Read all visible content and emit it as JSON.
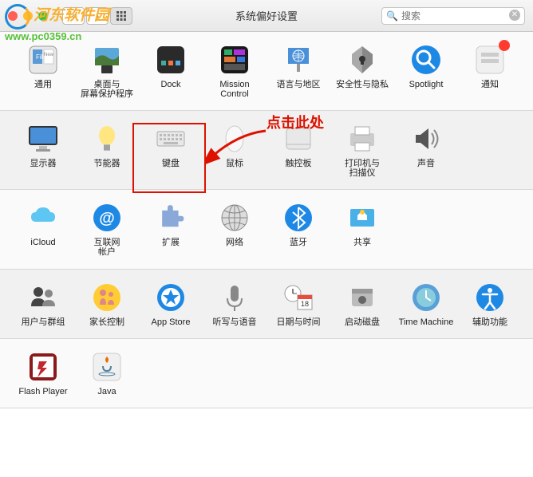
{
  "window": {
    "title": "系统偏好设置"
  },
  "search": {
    "placeholder": "搜索"
  },
  "callout": "点击此处",
  "watermark": {
    "text": "河东软件园",
    "url": "www.pc0359.cn"
  },
  "rows": [
    [
      {
        "key": "general",
        "label": "通用"
      },
      {
        "key": "desktop",
        "label": "桌面与\n屏幕保护程序"
      },
      {
        "key": "dock",
        "label": "Dock"
      },
      {
        "key": "mission",
        "label": "Mission\nControl"
      },
      {
        "key": "language",
        "label": "语言与地区"
      },
      {
        "key": "security",
        "label": "安全性与隐私"
      },
      {
        "key": "spotlight",
        "label": "Spotlight"
      },
      {
        "key": "notifications",
        "label": "通知"
      }
    ],
    [
      {
        "key": "displays",
        "label": "显示器"
      },
      {
        "key": "energy",
        "label": "节能器"
      },
      {
        "key": "keyboard",
        "label": "键盘"
      },
      {
        "key": "mouse",
        "label": "鼠标"
      },
      {
        "key": "trackpad",
        "label": "触控板"
      },
      {
        "key": "printers",
        "label": "打印机与\n扫描仪"
      },
      {
        "key": "sound",
        "label": "声音"
      }
    ],
    [
      {
        "key": "icloud",
        "label": "iCloud"
      },
      {
        "key": "internet",
        "label": "互联网\n帐户"
      },
      {
        "key": "extensions",
        "label": "扩展"
      },
      {
        "key": "network",
        "label": "网络"
      },
      {
        "key": "bluetooth",
        "label": "蓝牙"
      },
      {
        "key": "sharing",
        "label": "共享"
      }
    ],
    [
      {
        "key": "users",
        "label": "用户与群组"
      },
      {
        "key": "parental",
        "label": "家长控制"
      },
      {
        "key": "appstore",
        "label": "App Store"
      },
      {
        "key": "dictation",
        "label": "听写与语音"
      },
      {
        "key": "datetime",
        "label": "日期与时间"
      },
      {
        "key": "startup",
        "label": "启动磁盘"
      },
      {
        "key": "timemachine",
        "label": "Time Machine"
      },
      {
        "key": "accessibility",
        "label": "辅助功能"
      }
    ],
    [
      {
        "key": "flash",
        "label": "Flash Player"
      },
      {
        "key": "java",
        "label": "Java"
      }
    ]
  ]
}
